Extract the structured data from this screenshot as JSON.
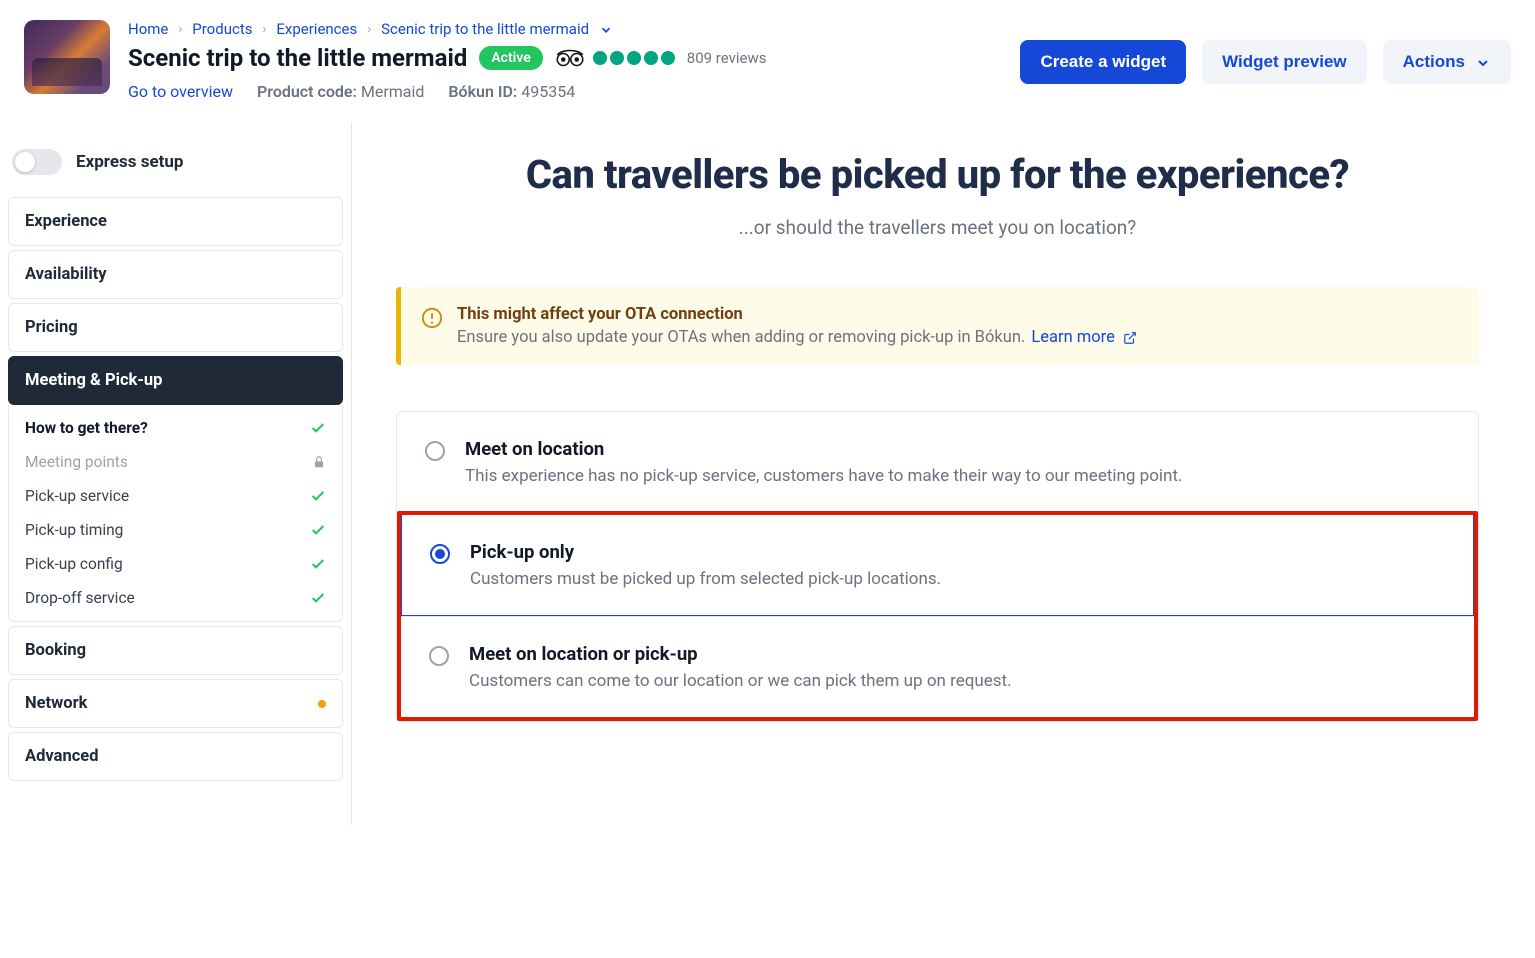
{
  "breadcrumb": {
    "home": "Home",
    "products": "Products",
    "experiences": "Experiences",
    "current": "Scenic trip to the little mermaid"
  },
  "header": {
    "title": "Scenic trip to the little mermaid",
    "status_badge": "Active",
    "reviews": "809 reviews",
    "overview_link": "Go to overview",
    "code_label": "Product code:",
    "code_value": "Mermaid",
    "bokun_label": "Bókun ID:",
    "bokun_value": "495354"
  },
  "actions": {
    "create": "Create a widget",
    "preview": "Widget preview",
    "menu": "Actions"
  },
  "sidebar": {
    "express": "Express setup",
    "experience": "Experience",
    "availability": "Availability",
    "pricing": "Pricing",
    "meeting": "Meeting & Pick-up",
    "sub": {
      "how": "How to get there?",
      "meeting_points": "Meeting points",
      "pickup_service": "Pick-up service",
      "pickup_timing": "Pick-up timing",
      "pickup_config": "Pick-up config",
      "dropoff": "Drop-off service"
    },
    "booking": "Booking",
    "network": "Network",
    "advanced": "Advanced"
  },
  "main": {
    "heading": "Can travellers be picked up for the experience?",
    "subheading": "...or should the travellers meet you on location?"
  },
  "alert": {
    "title": "This might affect your OTA connection",
    "body": "Ensure you also update your OTAs when adding or removing pick-up in Bókun.",
    "learn_more": "Learn more"
  },
  "options": {
    "meet": {
      "title": "Meet on location",
      "desc": "This experience has no pick-up service, customers have to make their way to our meeting point."
    },
    "pickup_only": {
      "title": "Pick-up only",
      "desc": "Customers must be picked up from selected pick-up locations."
    },
    "meet_or_pickup": {
      "title": "Meet on location or pick-up",
      "desc": "Customers can come to our location or we can pick them up on request."
    }
  }
}
